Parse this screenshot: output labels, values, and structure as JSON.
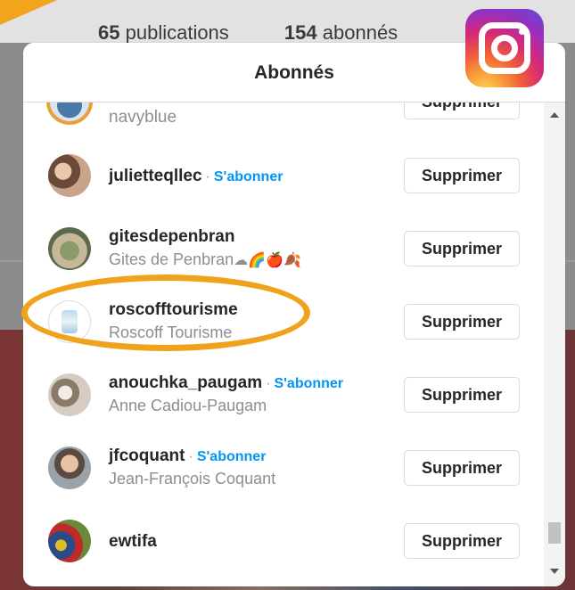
{
  "background": {
    "stats": [
      {
        "count": "65",
        "label": "publications"
      },
      {
        "count": "154",
        "label": "abonnés"
      }
    ]
  },
  "modal": {
    "title": "Abonnés",
    "remove_label": "Supprimer",
    "follow_label": "S'abonner",
    "rows": [
      {
        "username": "navyblue",
        "fullname": "",
        "follow": false
      },
      {
        "username": "julietteqllec",
        "fullname": "",
        "follow": true
      },
      {
        "username": "gitesdepenbran",
        "fullname": "Gites de Penbran",
        "follow": false
      },
      {
        "username": "roscofftourisme",
        "fullname": "Roscoff Tourisme",
        "follow": false,
        "highlighted": true
      },
      {
        "username": "anouchka_paugam",
        "fullname": "Anne Cadiou-Paugam",
        "follow": true
      },
      {
        "username": "jfcoquant",
        "fullname": "Jean-François Coquant",
        "follow": true
      },
      {
        "username": "ewtifa",
        "fullname": "",
        "follow": false
      }
    ]
  },
  "colors": {
    "accent_link": "#0095f6",
    "highlight": "#f0a21c"
  },
  "icons": {
    "logo": "instagram-logo-icon",
    "scroll_up": "scroll-up-arrow-icon",
    "scroll_down": "scroll-down-arrow-icon"
  }
}
